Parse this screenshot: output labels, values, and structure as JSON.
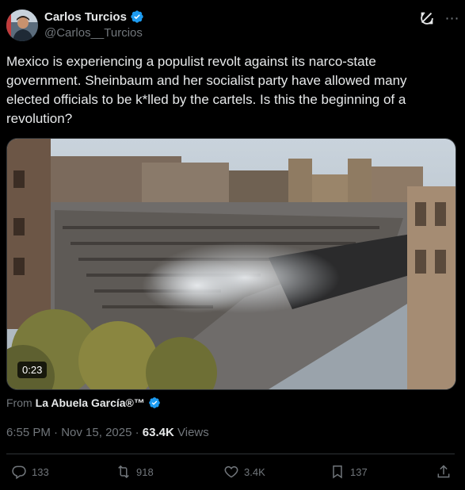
{
  "author": {
    "name": "Carlos Turcios",
    "handle": "@Carlos__Turcios",
    "verified": true
  },
  "tweet": {
    "text": "Mexico is experiencing a populist revolt against its narco-state government. Sheinbaum and her socialist party have allowed many elected officials to be k*lled by the cartels. Is this the beginning of a revolution?"
  },
  "media": {
    "duration": "0:23"
  },
  "source": {
    "prefix": "From",
    "name": "La Abuela García®™"
  },
  "meta": {
    "time": "6:55 PM",
    "date": "Nov 15, 2025",
    "separator": " · ",
    "views_count": "63.4K",
    "views_label": "Views"
  },
  "actions": {
    "replies": "133",
    "reposts": "918",
    "likes": "3.4K",
    "bookmarks": "137"
  },
  "colors": {
    "background": "#000000",
    "text": "#e7e9ea",
    "muted": "#71767b",
    "verified": "#1d9bf0",
    "divider": "#2f3336"
  }
}
